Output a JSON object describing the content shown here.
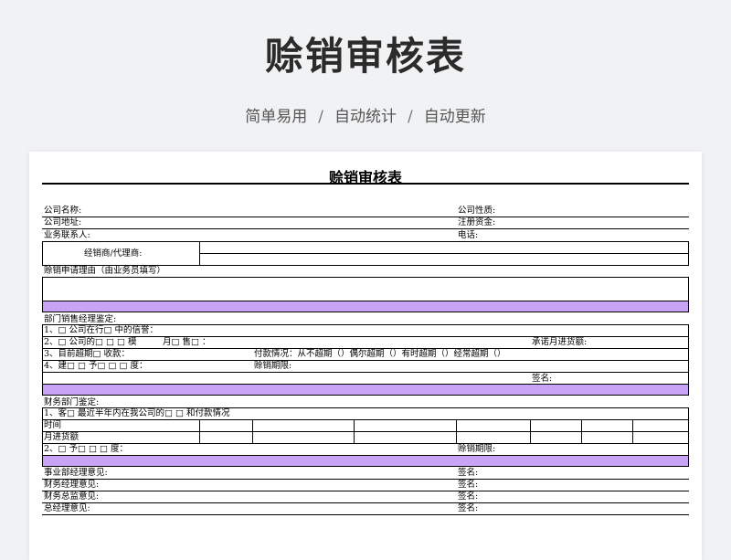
{
  "hero": {
    "title": "赊销审核表",
    "tags": [
      "简单易用",
      "自动统计",
      "自动更新"
    ],
    "separator": "/"
  },
  "form": {
    "title": "赊销审核表",
    "company_name": "公司名称:",
    "company_nature": "公司性质:",
    "company_address": "公司地址:",
    "registered_capital": "注册资金:",
    "business_contact": "业务联系人:",
    "phone": "电话:",
    "distributor": "经销商/代理商:",
    "credit_reason": "赊销申请理由（由业务员填写）",
    "sales_manager_appraisal": "部门销售经理鉴定:",
    "sm_item1": "1、□ 公司在行□ 中的信誉：",
    "sm_item2": "2、□ 公司的□ □ □ 模",
    "sm_item2_month": "月□ 售□ ：",
    "sm_item2_commit": "承诺月进货额:",
    "sm_item3": "3、目前超期□ 收款：",
    "sm_item3_payment": "付款情况：从不超期（）偶尔超期（）有时超期（）经常超期（）",
    "sm_item4": "4、建□ □ 予□ □ □ 度：",
    "sm_item4_term": "赊销期限:",
    "sm_signature": "签名:",
    "finance_appraisal": "财务部门鉴定:",
    "fin_item1": "1、客□ 最近半年内在我公司的□ □ 和付款情况",
    "fin_time": "时间",
    "fin_monthly": "月进货额",
    "fin_item2": "2、□ 予□ □ □ 度：",
    "fin_term": "赊销期限:",
    "division_manager": "事业部经理意见:",
    "finance_manager": "财务经理意见:",
    "finance_director": "财务总监意见:",
    "general_manager": "总经理意见:",
    "signature": "签名:"
  }
}
